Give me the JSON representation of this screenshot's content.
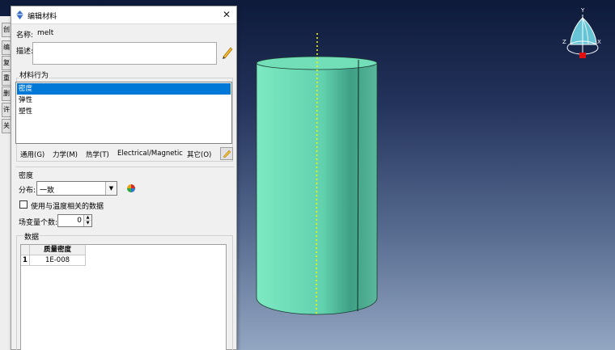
{
  "dialog": {
    "title": "编辑材料",
    "name_label": "名称:",
    "name_value": "melt",
    "description_label": "描述:",
    "description_value": "",
    "behavior_group_label": "材料行为",
    "behaviors": [
      "密度",
      "弹性",
      "塑性"
    ],
    "selected_behavior": "密度",
    "menus": [
      "通用(G)",
      "力学(M)",
      "热学(T)",
      "Electrical/Magnetic",
      "其它(O)"
    ],
    "section_title": "密度",
    "distribution_label": "分布:",
    "distribution_value": "一致",
    "temp_dependent_label": "使用与温度相关的数据",
    "temp_dependent_checked": false,
    "field_vars_label": "场变量个数:",
    "field_vars_value": "0",
    "data_group_label": "数据",
    "table": {
      "columns": [
        "质量密度"
      ],
      "rows": [
        {
          "index": "1",
          "values": [
            "1E-008"
          ]
        }
      ]
    }
  },
  "left_toolbar": {
    "buttons": [
      "创",
      "编",
      "复",
      "重",
      "删",
      "许",
      "关"
    ]
  },
  "viewport": {
    "triad": {
      "y": "Y",
      "z": "Z",
      "x": "X"
    },
    "colors": {
      "cylinder_face": "#6fe0b8",
      "cylinder_side": "#4ba489",
      "axis_line": "#f5f500",
      "background_top": "#0d1a3a",
      "background_bottom": "#93a6c2"
    }
  }
}
